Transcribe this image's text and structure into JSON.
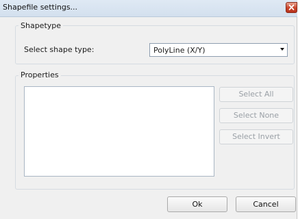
{
  "window": {
    "title": "Shapefile settings...",
    "close_icon": "close-icon",
    "close_color": "#c8432a"
  },
  "shapetype": {
    "group_label": "Shapetype",
    "select_label": "Select shape type:",
    "selected_value": "PolyLine (X/Y)"
  },
  "properties": {
    "group_label": "Properties",
    "items": [],
    "buttons": {
      "select_all": "Select All",
      "select_none": "Select None",
      "select_invert": "Select Invert"
    }
  },
  "footer": {
    "ok_label": "Ok",
    "cancel_label": "Cancel"
  }
}
